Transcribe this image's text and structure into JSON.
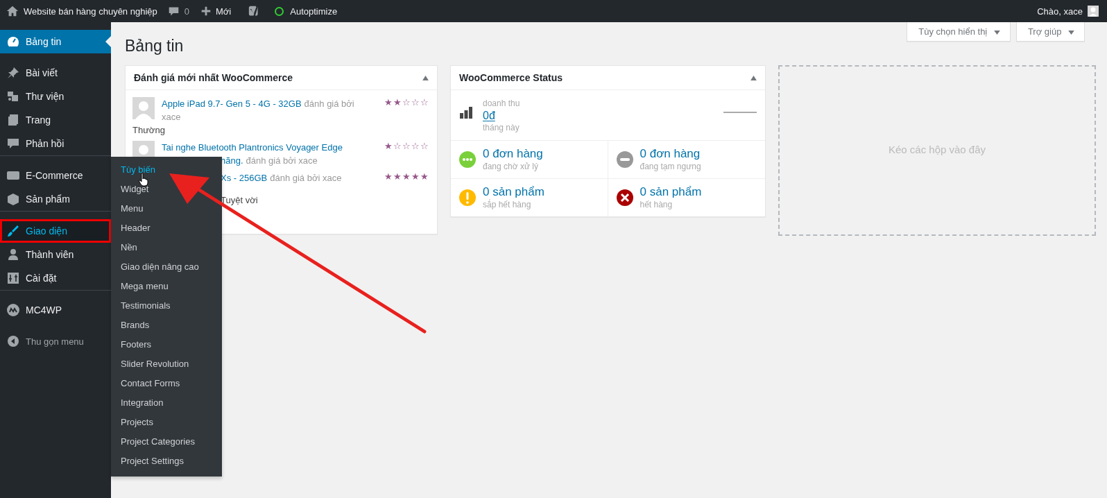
{
  "admin_bar": {
    "site_name": "Website bán hàng chuyên nghiệp",
    "comments": "0",
    "new_label": "Mới",
    "autoptimize": "Autoptimize",
    "greeting": "Chào, xace"
  },
  "sidebar": {
    "groups": [
      {
        "divider_before": false,
        "items": [
          {
            "label": "Bảng tin",
            "kind": "dashboard",
            "selected": true,
            "outlined": false
          }
        ]
      },
      {
        "divider_before": false,
        "items": [
          {
            "label": "Bài viết",
            "kind": "pin",
            "selected": false,
            "outlined": false
          },
          {
            "label": "Thư viện",
            "kind": "media",
            "selected": false,
            "outlined": false
          },
          {
            "label": "Trang",
            "kind": "page",
            "selected": false,
            "outlined": false
          },
          {
            "label": "Phản hồi",
            "kind": "comment",
            "selected": false,
            "outlined": false
          }
        ]
      },
      {
        "divider_before": true,
        "items": [
          {
            "label": "E-Commerce",
            "kind": "woo",
            "selected": false,
            "outlined": false
          },
          {
            "label": "Sản phẩm",
            "kind": "box",
            "selected": false,
            "outlined": false
          }
        ]
      },
      {
        "divider_before": true,
        "items": [
          {
            "label": "Giao diện",
            "kind": "brush",
            "selected": false,
            "outlined": true
          },
          {
            "label": "Thành viên",
            "kind": "user",
            "selected": false,
            "outlined": false
          },
          {
            "label": "Cài đặt",
            "kind": "settings",
            "selected": false,
            "outlined": false
          }
        ]
      },
      {
        "divider_before": true,
        "items": [
          {
            "label": "MC4WP",
            "kind": "mc4wp",
            "selected": false,
            "outlined": false
          }
        ]
      },
      {
        "divider_before": false,
        "items": [
          {
            "label": "Thu gọn menu",
            "kind": "collapse",
            "selected": false,
            "outlined": false
          }
        ]
      }
    ]
  },
  "submenu": {
    "items": [
      {
        "label": "Tùy biến",
        "selected": true
      },
      {
        "label": "Widget",
        "selected": false
      },
      {
        "label": "Menu",
        "selected": false
      },
      {
        "label": "Header",
        "selected": false
      },
      {
        "label": "Nền",
        "selected": false
      },
      {
        "label": "Giao diện nâng cao",
        "selected": false
      },
      {
        "label": "Mega menu",
        "selected": false
      },
      {
        "label": "Testimonials",
        "selected": false
      },
      {
        "label": "Brands",
        "selected": false
      },
      {
        "label": "Footers",
        "selected": false
      },
      {
        "label": "Slider Revolution",
        "selected": false
      },
      {
        "label": "Contact Forms",
        "selected": false
      },
      {
        "label": "Integration",
        "selected": false
      },
      {
        "label": "Projects",
        "selected": false
      },
      {
        "label": "Project Categories",
        "selected": false
      },
      {
        "label": "Project Settings",
        "selected": false
      }
    ]
  },
  "screen_buttons": [
    "Tùy chọn hiển thị",
    "Trợ giúp"
  ],
  "page_title": "Bảng tin",
  "reviews_card": {
    "title": "Đánh giá mới nhất WooCommerce",
    "reviews": [
      {
        "avatar": true,
        "stars": 2,
        "lines": [
          [
            {
              "text": "Apple iPad 9.7- Gen 5 - 4G - 32GB",
              "link": true
            },
            {
              "text": "đánh giá bởi",
              "link": false
            }
          ],
          [
            {
              "text": "xace",
              "link": false
            }
          ]
        ],
        "comment": "Thường"
      },
      {
        "avatar": true,
        "stars": 1,
        "lines": [
          [
            {
              "text": "Tai nghe Bluetooth Plantronics Voyager Edge",
              "link": true
            }
          ],
          [
            {
              "text": "hãng.",
              "link": true
            },
            {
              "text": "đánh giá bởi xace",
              "link": false
            }
          ]
        ]
      },
      {
        "avatar": false,
        "stars": 5,
        "lines": [
          [
            {
              "text": "Xs - 256GB",
              "link": true
            },
            {
              "text": "đánh giá bởi xace",
              "link": false
            }
          ]
        ],
        "comment": "Tuyệt vời"
      }
    ]
  },
  "status_card": {
    "title": "WooCommerce Status",
    "revenue": {
      "label": "doanh thu",
      "value": "0đ",
      "period": "tháng này"
    },
    "items": [
      {
        "kind": "processing",
        "value": "0 đơn hàng",
        "label": "đang chờ xử lý"
      },
      {
        "kind": "on_hold",
        "value": "0 đơn hàng",
        "label": "đang tạm ngưng"
      },
      {
        "kind": "low_stock",
        "value": "0 sản phẩm",
        "label": "sắp hết hàng"
      },
      {
        "kind": "out_of_stock",
        "value": "0 sản phẩm",
        "label": "hết hàng"
      }
    ]
  },
  "drop_zone": {
    "text": "Kéo các hộp vào đây"
  }
}
